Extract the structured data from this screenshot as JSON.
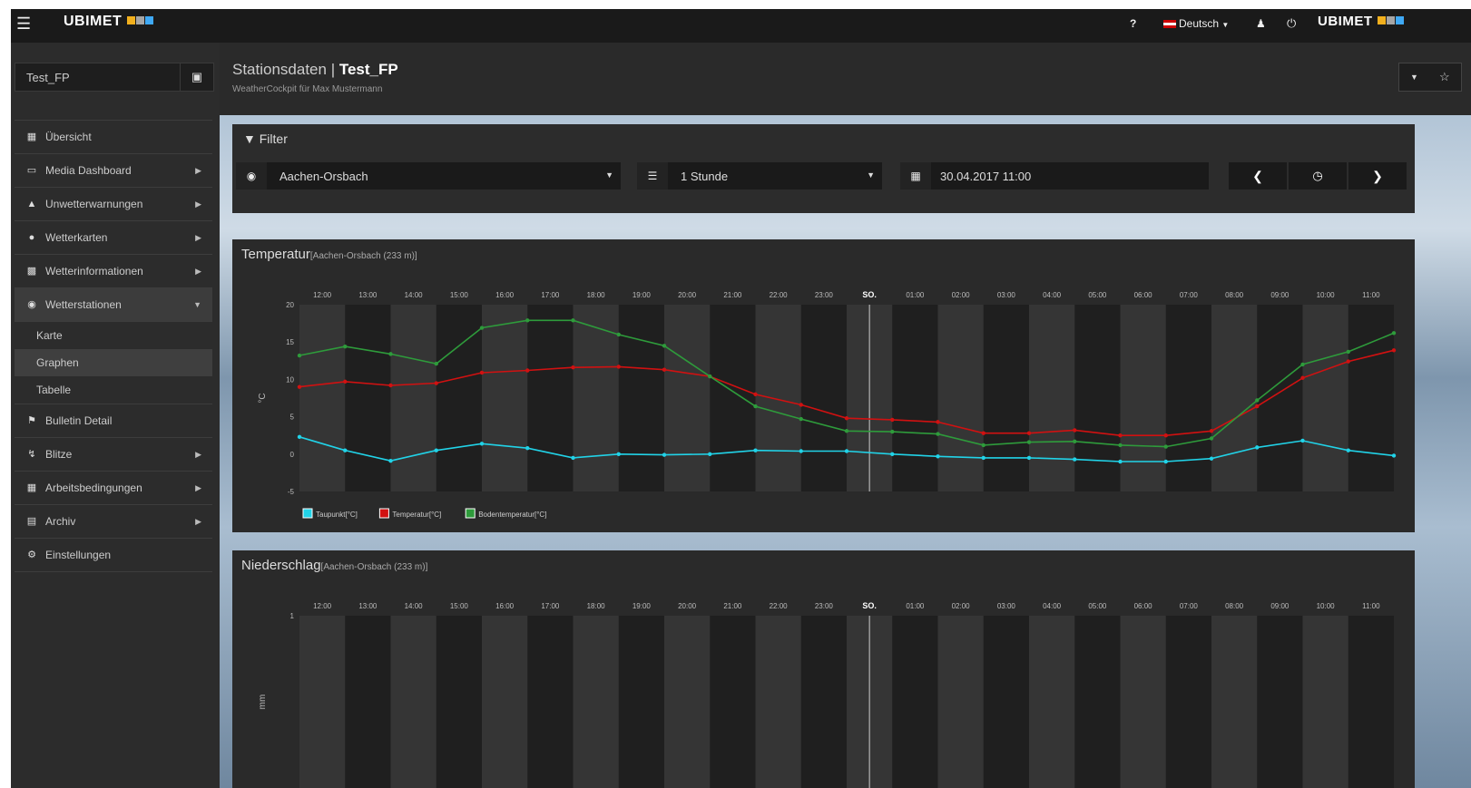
{
  "app": {
    "brand": "UBIMET",
    "brand_colors": [
      "#f2b01e",
      "#a6a6a6",
      "#3fa9f5"
    ]
  },
  "topbar": {
    "help": "?",
    "language": "Deutsch",
    "brand": "UBIMET"
  },
  "sidebar": {
    "station": "Test_FP",
    "items": [
      {
        "label": "Übersicht",
        "icon": "grid-icon",
        "caret": false
      },
      {
        "label": "Media Dashboard",
        "icon": "monitor-icon",
        "caret": true
      },
      {
        "label": "Unwetterwarnungen",
        "icon": "warning-icon",
        "caret": true
      },
      {
        "label": "Wetterkarten",
        "icon": "globe-icon",
        "caret": true
      },
      {
        "label": "Wetterinformationen",
        "icon": "bar-chart-icon",
        "caret": true
      },
      {
        "label": "Wetterstationen",
        "icon": "target-icon",
        "caret": true,
        "open": true
      }
    ],
    "subitems": [
      "Karte",
      "Graphen",
      "Tabelle"
    ],
    "items2": [
      {
        "label": "Bulletin Detail",
        "icon": "flag-icon",
        "caret": false
      },
      {
        "label": "Blitze",
        "icon": "bolt-icon",
        "caret": true
      },
      {
        "label": "Arbeitsbedingungen",
        "icon": "table-icon",
        "caret": true
      },
      {
        "label": "Archiv",
        "icon": "archive-icon",
        "caret": true
      },
      {
        "label": "Einstellungen",
        "icon": "cogs-icon",
        "caret": false
      }
    ]
  },
  "header": {
    "title_prefix": "Stationsdaten",
    "separator": "|",
    "title": "Test_FP",
    "subtitle": "WeatherCockpit für Max Mustermann"
  },
  "filter": {
    "title": "Filter",
    "station": "Aachen-Orsbach",
    "interval": "1 Stunde",
    "datetime": "30.04.2017 11:00"
  },
  "panels": {
    "temp": {
      "title": "Temperatur",
      "location": "[Aachen-Orsbach (233 m)]"
    },
    "precip": {
      "title": "Niederschlag",
      "location": "[Aachen-Orsbach (233 m)]"
    }
  },
  "chart_data": [
    {
      "type": "line",
      "x": [
        "12:00",
        "13:00",
        "14:00",
        "15:00",
        "16:00",
        "17:00",
        "18:00",
        "19:00",
        "20:00",
        "21:00",
        "22:00",
        "23:00",
        "SO.",
        "01:00",
        "02:00",
        "03:00",
        "04:00",
        "05:00",
        "06:00",
        "07:00",
        "08:00",
        "09:00",
        "10:00",
        "11:00"
      ],
      "ylabel": "°C",
      "yticks": [
        20,
        15,
        10,
        5,
        0,
        -5
      ],
      "ylim": [
        -5,
        20
      ],
      "series": [
        {
          "name": "Taupunkt[°C]",
          "color": "#21d3e8",
          "values": [
            2.3,
            0.5,
            -0.9,
            0.5,
            1.4,
            0.8,
            -0.5,
            0,
            -0.1,
            0,
            0.5,
            0.4,
            0.4,
            0,
            -0.3,
            -0.5,
            -0.5,
            -0.7,
            -1,
            -1,
            -0.6,
            0.9,
            1.8,
            0.5,
            -0.2
          ]
        },
        {
          "name": "Temperatur[°C]",
          "color": "#d11111",
          "values": [
            9,
            9.7,
            9.2,
            9.5,
            10.9,
            11.2,
            11.6,
            11.7,
            11.3,
            10.4,
            8,
            6.6,
            4.8,
            4.6,
            4.3,
            2.8,
            2.8,
            3.2,
            2.5,
            2.5,
            3.1,
            6.4,
            10.2,
            12.4,
            13.9
          ]
        },
        {
          "name": "Bodentemperatur[°C]",
          "color": "#2e9b3b",
          "values": [
            13.2,
            14.4,
            13.4,
            12.1,
            16.9,
            17.9,
            17.9,
            16,
            14.5,
            10.4,
            6.4,
            4.7,
            3.1,
            3,
            2.7,
            1.2,
            1.6,
            1.7,
            1.2,
            1,
            2.1,
            7.2,
            12,
            13.7,
            16.2
          ]
        }
      ]
    },
    {
      "type": "bar",
      "x": [
        "12:00",
        "13:00",
        "14:00",
        "15:00",
        "16:00",
        "17:00",
        "18:00",
        "19:00",
        "20:00",
        "21:00",
        "22:00",
        "23:00",
        "SO.",
        "01:00",
        "02:00",
        "03:00",
        "04:00",
        "05:00",
        "06:00",
        "07:00",
        "08:00",
        "09:00",
        "10:00",
        "11:00"
      ],
      "ylabel": "mm",
      "yticks": [
        1
      ],
      "values": []
    }
  ]
}
